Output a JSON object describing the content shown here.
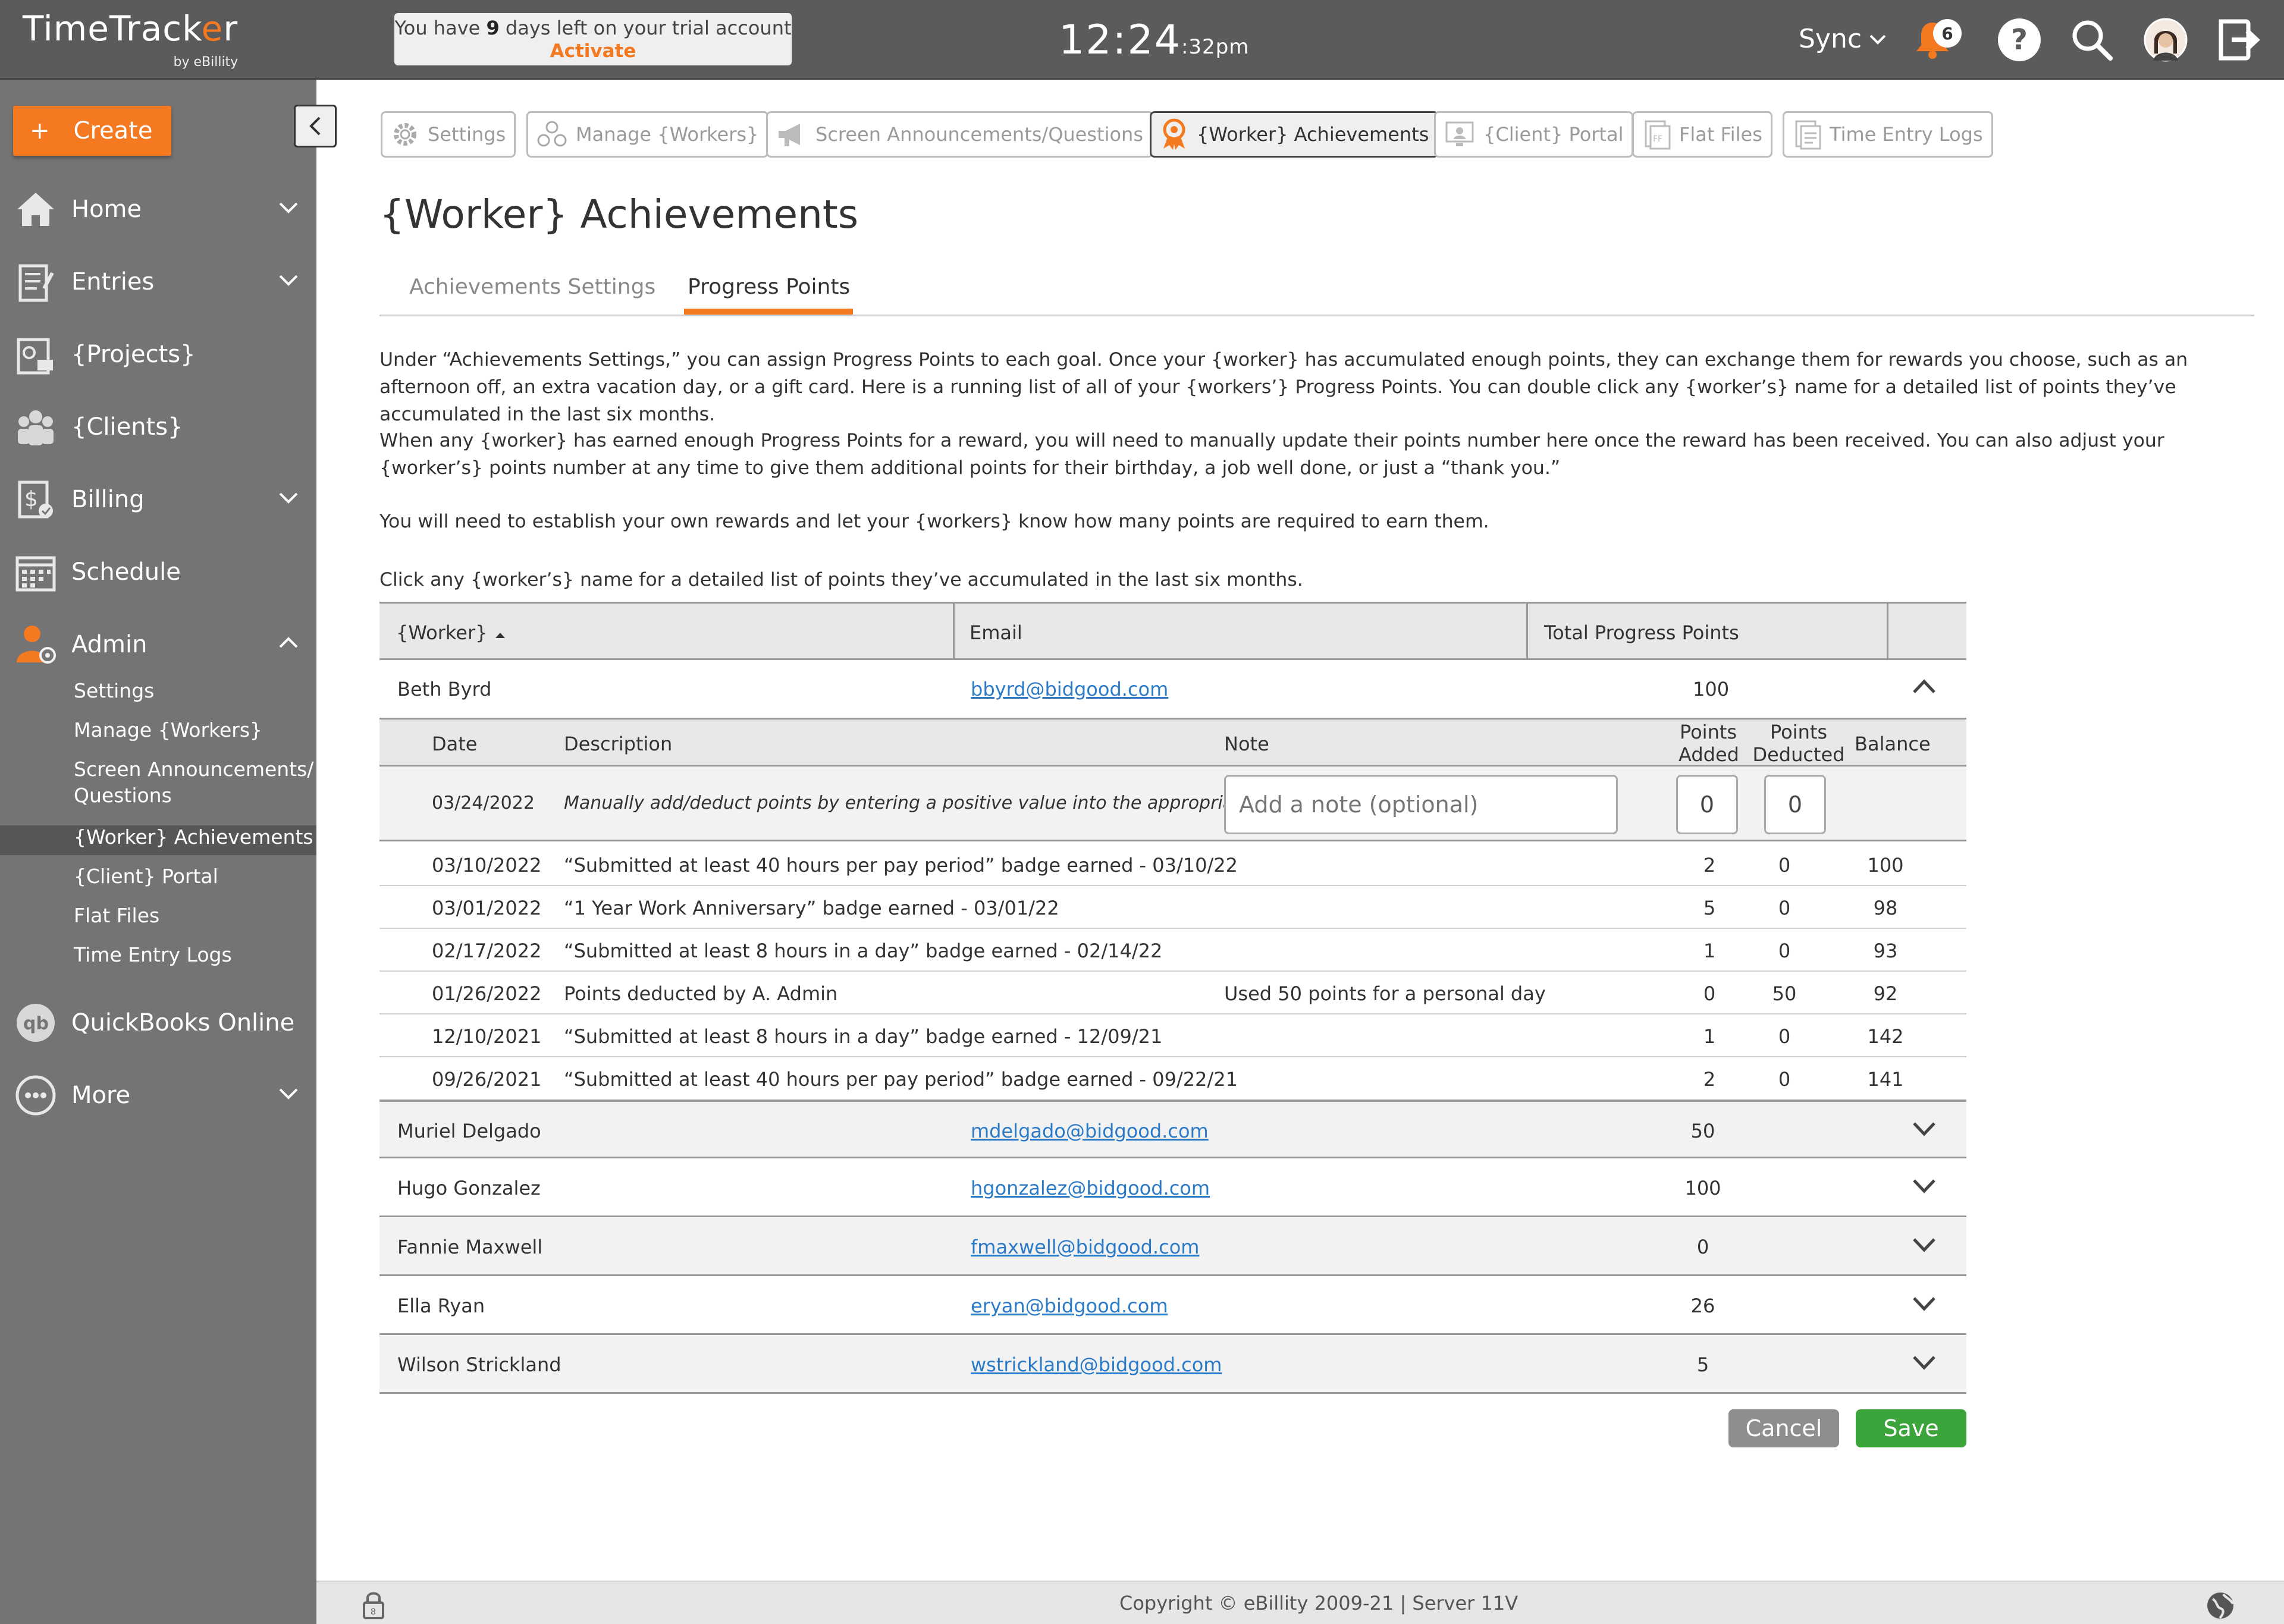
{
  "app": {
    "logo_text_a": "TimeTrack",
    "logo_text_o": "e",
    "logo_text_b": "r",
    "logo_sub": "by eBillity"
  },
  "trial": {
    "prefix": "You have ",
    "days": "9",
    "suffix": " days left on your trial account",
    "activate": "Activate"
  },
  "clock": {
    "time": "12:24",
    "seconds_ampm": ":32pm"
  },
  "topbar": {
    "sync_label": "Sync",
    "notification_count": "6",
    "help_label": "?"
  },
  "sidebar": {
    "create_label": "Create",
    "create_plus": "+",
    "items": [
      {
        "label": "Home"
      },
      {
        "label": "Entries"
      },
      {
        "label": "{Projects}"
      },
      {
        "label": "{Clients}"
      },
      {
        "label": "Billing"
      },
      {
        "label": "Schedule"
      },
      {
        "label": "Admin"
      },
      {
        "label": "QuickBooks Online"
      },
      {
        "label": "More"
      }
    ],
    "admin_subitems": [
      "Settings",
      "Manage {Workers}",
      "Screen Announcements/",
      "Questions",
      "{Worker} Achievements",
      "{Client} Portal",
      "Flat Files",
      "Time Entry Logs"
    ]
  },
  "toolbar": [
    "Settings",
    "Manage {Workers}",
    "Screen Announcements/Questions",
    "{Worker} Achievements",
    "{Client} Portal",
    "Flat Files",
    "Time Entry Logs"
  ],
  "page": {
    "title": "{Worker} Achievements",
    "tab_settings": "Achievements Settings",
    "tab_points": "Progress Points",
    "para1": "Under “Achievements Settings,” you can assign Progress Points to each goal. Once your {worker} has accumulated enough points, they can exchange them for rewards you choose, such as an afternoon off, an extra vacation day, or a gift card. Here is a running list of all of your {workers’} Progress Points. You can double click any {worker’s} name for a detailed list of points they’ve accumulated in the last six months.",
    "para2": "When any {worker} has earned enough Progress Points for a reward, you will need to manually update their points number here once the reward has been received. You can also adjust your {worker’s} points number at any time to give them additional points for their birthday, a job well done, or just a “thank you.”",
    "para3": "You will need to establish your own rewards and let your {workers} know how many points are required to earn them.",
    "para4": "Click any {worker’s} name for a detailed list of points they’ve accumulated in the last six months."
  },
  "table": {
    "col_worker": "{Worker}",
    "col_email": "Email",
    "col_total": "Total Progress Points",
    "expanded": {
      "name": "Beth Byrd",
      "email": "bbyrd@bidgood.com",
      "total": "100"
    },
    "sub_headers": {
      "date": "Date",
      "description": "Description",
      "note": "Note",
      "added_1": "Points",
      "added_2": "Added",
      "deducted_1": "Points",
      "deducted_2": "Deducted",
      "balance": "Balance"
    },
    "add_row": {
      "date": "03/24/2022",
      "description": "Manually add/deduct points by entering a positive value into the appropriate box",
      "note_placeholder": "Add a note (optional)",
      "added_value": "0",
      "deducted_value": "0"
    },
    "history": [
      {
        "date": "03/10/2022",
        "description": "“Submitted at least 40 hours per pay period” badge earned - 03/10/22",
        "note": "",
        "added": "2",
        "deducted": "0",
        "balance": "100"
      },
      {
        "date": "03/01/2022",
        "description": "“1 Year Work Anniversary” badge earned - 03/01/22",
        "note": "",
        "added": "5",
        "deducted": "0",
        "balance": "98"
      },
      {
        "date": "02/17/2022",
        "description": "“Submitted at least 8 hours in a day” badge earned - 02/14/22",
        "note": "",
        "added": "1",
        "deducted": "0",
        "balance": "93"
      },
      {
        "date": "01/26/2022",
        "description": "Points deducted by A. Admin",
        "note": "Used 50 points for a personal day",
        "added": "0",
        "deducted": "50",
        "balance": "92"
      },
      {
        "date": "12/10/2021",
        "description": "“Submitted at least 8 hours in a day” badge earned - 12/09/21",
        "note": "",
        "added": "1",
        "deducted": "0",
        "balance": "142"
      },
      {
        "date": "09/26/2021",
        "description": "“Submitted at least 40 hours per pay period” badge earned - 09/22/21",
        "note": "",
        "added": "2",
        "deducted": "0",
        "balance": "141"
      }
    ],
    "workers": [
      {
        "name": "Muriel Delgado",
        "email": "mdelgado@bidgood.com",
        "total": "50"
      },
      {
        "name": "Hugo Gonzalez",
        "email": "hgonzalez@bidgood.com",
        "total": "100"
      },
      {
        "name": "Fannie Maxwell",
        "email": "fmaxwell@bidgood.com",
        "total": "0"
      },
      {
        "name": "Ella Ryan",
        "email": "eryan@bidgood.com",
        "total": "26"
      },
      {
        "name": "Wilson Strickland",
        "email": "wstrickland@bidgood.com",
        "total": "5"
      }
    ]
  },
  "actions": {
    "cancel": "Cancel",
    "save": "Save"
  },
  "footer": {
    "copyright": "Copyright © eBillity 2009-21 | Server 11V"
  },
  "colors": {
    "accent": "#f47920",
    "sidebar": "#747474",
    "topbar": "#5b5b5b",
    "link": "#2a7ac8",
    "save": "#3ba53b"
  }
}
